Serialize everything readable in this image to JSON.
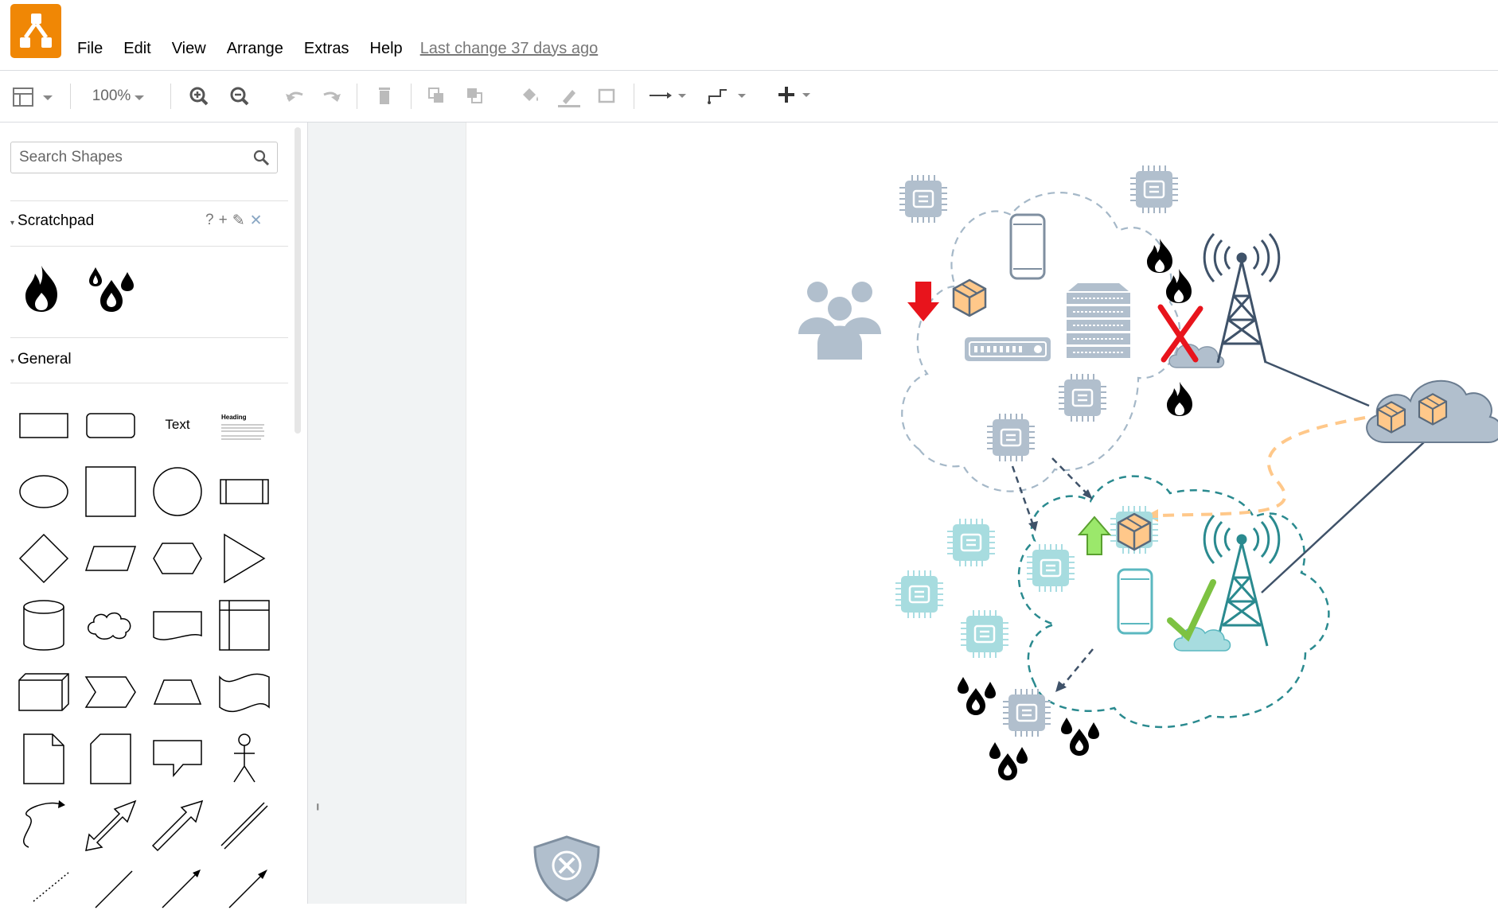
{
  "header": {
    "logo_icon": "drawio-logo-icon",
    "menu": [
      "File",
      "Edit",
      "View",
      "Arrange",
      "Extras",
      "Help"
    ],
    "last_change": "Last change 37 days ago"
  },
  "toolbar": {
    "zoom": "100%"
  },
  "sidebar": {
    "search_placeholder": "Search Shapes",
    "scratchpad": {
      "title": "Scratchpad",
      "actions": [
        "?",
        "+",
        "✎",
        "✕"
      ],
      "items": [
        "fire-icon",
        "water-drops-icon"
      ]
    },
    "general": {
      "title": "General",
      "text_shape_label": "Text",
      "heading_shape_label": "Heading"
    }
  },
  "colors": {
    "accent": "#f08705",
    "cloud_grey": "#a5b8c8",
    "teal": "#2a8a8f",
    "alert_red": "#e8141c",
    "ok_green": "#7dc242",
    "peach": "#ffc88a"
  }
}
